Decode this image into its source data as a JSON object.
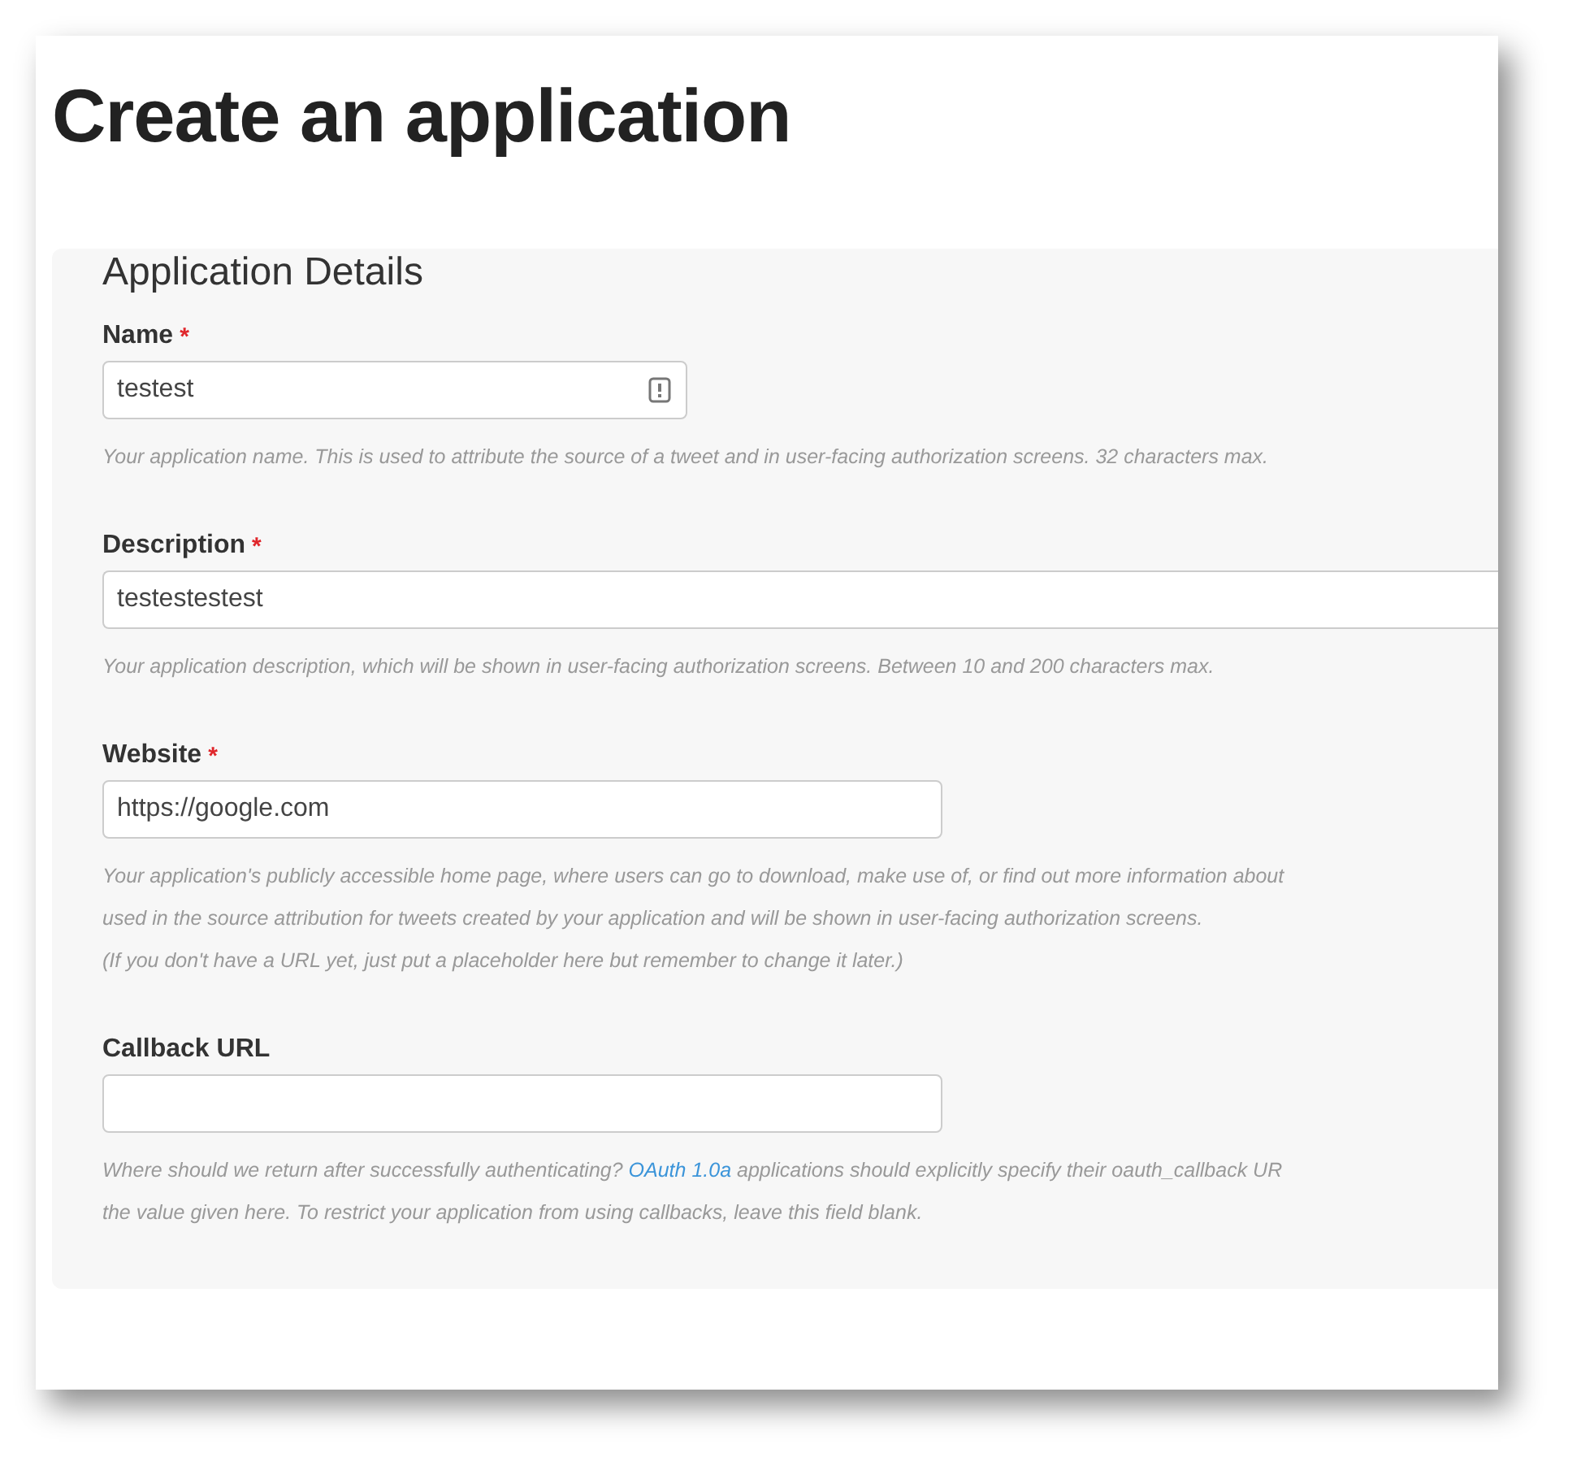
{
  "title": "Create an application",
  "section": {
    "heading": "Application Details",
    "fields": [
      {
        "label": "Name",
        "required_mark": "*",
        "kind": "short",
        "value": "testest",
        "validation_icon": true,
        "help": [
          [
            {
              "text": "Your application name. This is used to attribute the source of a tweet and in user-facing authorization screens. 32 characters max."
            }
          ]
        ]
      },
      {
        "label": "Description",
        "required_mark": "*",
        "kind": "full",
        "value": "testestestest",
        "validation_icon": false,
        "help": [
          [
            {
              "text": "Your application description, which will be shown in user-facing authorization screens. Between 10 and 200 characters max."
            }
          ]
        ]
      },
      {
        "label": "Website",
        "required_mark": "*",
        "kind": "medium",
        "value": "https://google.com",
        "validation_icon": false,
        "help": [
          [
            {
              "text": "Your application's publicly accessible home page, where users can go to download, make use of, or find out more information about"
            }
          ],
          [
            {
              "text": "used in the source attribution for tweets created by your application and will be shown in user-facing authorization screens."
            }
          ],
          [
            {
              "text": "(If you don't have a URL yet, just put a placeholder here but remember to change it later.)"
            }
          ]
        ]
      },
      {
        "label": "Callback URL",
        "kind": "medium",
        "validation_icon": false,
        "help": [
          [
            {
              "text": "Where should we return after successfully authenticating? "
            },
            {
              "link": "OAuth 1.0a"
            },
            {
              "text": " applications should explicitly specify their oauth_callback UR"
            }
          ],
          [
            {
              "text": "the value given here. To restrict your application from using callbacks, leave this field blank."
            }
          ]
        ]
      }
    ]
  }
}
